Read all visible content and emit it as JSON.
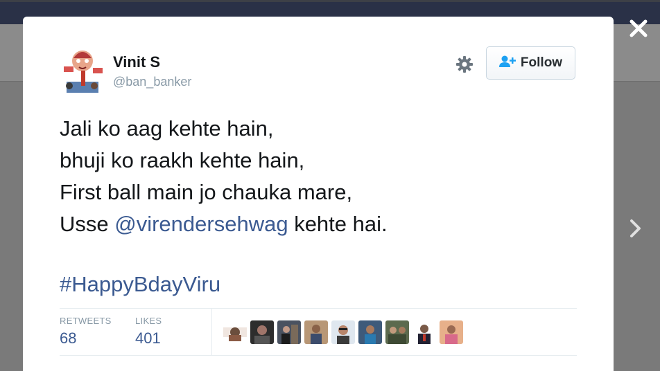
{
  "tweet": {
    "author_name": "Vinit S",
    "author_handle": "@ban_banker",
    "follow_label": "Follow",
    "lines": [
      "Jali ko aag kehte hain,",
      "bhuji ko raakh kehte hain,",
      "First ball main jo chauka mare,"
    ],
    "last_line_prefix": "Usse ",
    "mention": "@virendersehwag",
    "last_line_suffix": " kehte hai.",
    "hashtag": "#HappyBdayViru"
  },
  "stats": {
    "retweets_label": "RETWEETS",
    "retweets_count": "68",
    "likes_label": "LIKES",
    "likes_count": "401"
  },
  "likers": [
    {
      "icon": "liker-avatar"
    },
    {
      "icon": "liker-avatar"
    },
    {
      "icon": "liker-avatar"
    },
    {
      "icon": "liker-avatar"
    },
    {
      "icon": "liker-avatar"
    },
    {
      "icon": "liker-avatar"
    },
    {
      "icon": "liker-avatar"
    },
    {
      "icon": "liker-avatar"
    },
    {
      "icon": "liker-avatar"
    }
  ],
  "colors": {
    "link": "#3b5a91",
    "text": "#14171a",
    "muted": "#8899a6",
    "follow_icon": "#1da1f2"
  }
}
